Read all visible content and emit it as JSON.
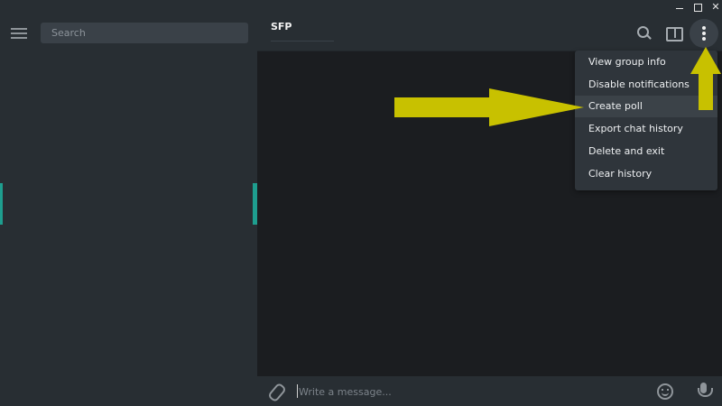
{
  "titlebar": {
    "minimize_label": "",
    "maximize_label": "",
    "close_label": "✕"
  },
  "sidebar": {
    "search_placeholder": "Search"
  },
  "chat": {
    "title": "SFP"
  },
  "header_icons": [
    "search-icon",
    "sidebar-toggle-icon",
    "more-vertical-icon"
  ],
  "menu": {
    "items": [
      {
        "label": "View group info"
      },
      {
        "label": "Disable notifications"
      },
      {
        "label": "Create poll",
        "active": true
      },
      {
        "label": "Export chat history"
      },
      {
        "label": "Delete and exit"
      },
      {
        "label": "Clear history"
      }
    ]
  },
  "composer": {
    "placeholder": "Write a message..."
  },
  "colors": {
    "accent": "#1e9e8f",
    "annotation_arrow": "#c8c100",
    "panel_bg": "#282e33",
    "chat_bg": "#1b1d20"
  }
}
